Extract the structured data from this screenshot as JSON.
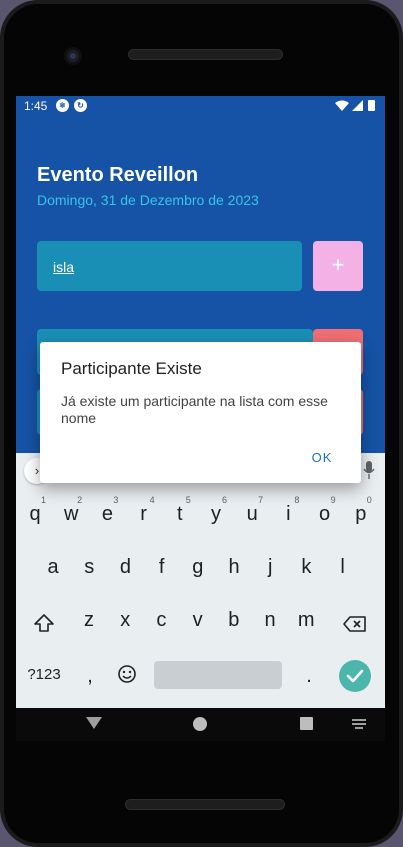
{
  "status_bar": {
    "time": "1:45",
    "app_icons": [
      "react-native-icon",
      "sync-icon"
    ],
    "system_icons": [
      "wifi-icon",
      "signal-icon",
      "battery-icon"
    ]
  },
  "event": {
    "title": "Evento Reveillon",
    "date": "Domingo, 31 de Dezembro de 2023"
  },
  "form": {
    "input_value": "isla",
    "add_label": "+"
  },
  "dialog": {
    "title": "Participante Existe",
    "message": "Já existe um participante na lista com esse nome",
    "ok_label": "OK"
  },
  "keyboard": {
    "row1": [
      {
        "k": "q",
        "h": "1"
      },
      {
        "k": "w",
        "h": "2"
      },
      {
        "k": "e",
        "h": "3"
      },
      {
        "k": "r",
        "h": "4"
      },
      {
        "k": "t",
        "h": "5"
      },
      {
        "k": "y",
        "h": "6"
      },
      {
        "k": "u",
        "h": "7"
      },
      {
        "k": "i",
        "h": "8"
      },
      {
        "k": "o",
        "h": "9"
      },
      {
        "k": "p",
        "h": "0"
      }
    ],
    "row2": [
      "a",
      "s",
      "d",
      "f",
      "g",
      "h",
      "j",
      "k",
      "l"
    ],
    "row3": [
      "z",
      "x",
      "c",
      "v",
      "b",
      "n",
      "m"
    ],
    "symbols_label": "?123",
    "comma": ",",
    "period": "."
  },
  "colors": {
    "app_bg": "#1652a5",
    "input_bg": "#1a8fb5",
    "add_button": "#f3b1e5",
    "remove_button": "#ef6f72",
    "date_text": "#38c6e6",
    "ok_text": "#1f6fb5"
  }
}
